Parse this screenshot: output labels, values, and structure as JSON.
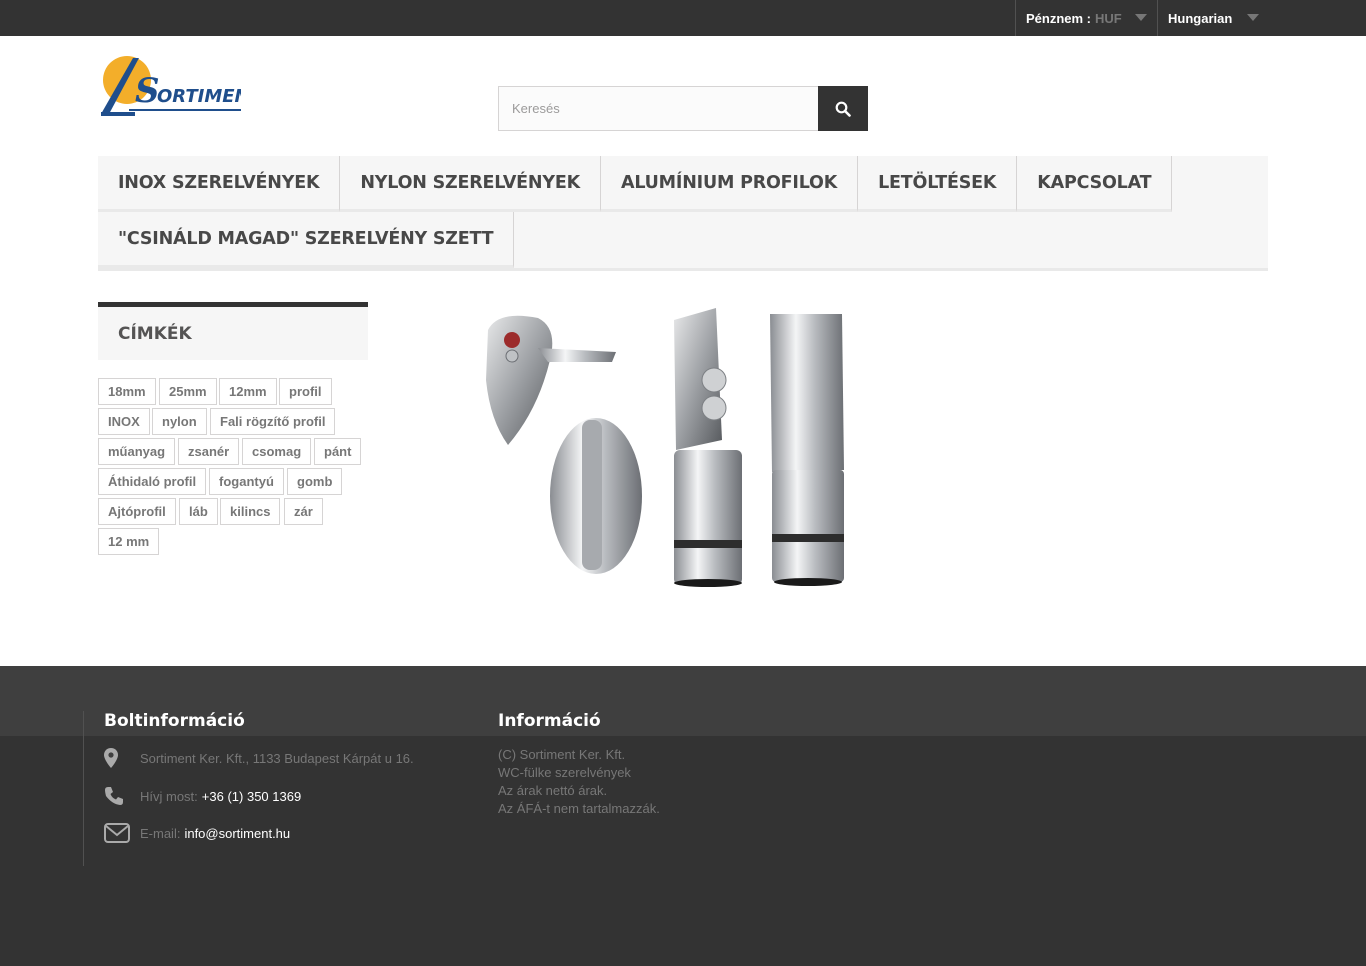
{
  "topbar": {
    "currency_label": "Pénznem :",
    "currency_value": "HUF",
    "language": "Hungarian"
  },
  "header": {
    "logo_text": "SORTIMENT",
    "search_placeholder": "Keresés",
    "search_icon": "search-icon"
  },
  "menu": {
    "row1": [
      "INOX SZERELVÉNYEK",
      "NYLON SZERELVÉNYEK",
      "ALUMÍNIUM PROFILOK",
      "LETÖLTÉSEK",
      "KAPCSOLAT"
    ],
    "row2": [
      "\"CSINÁLD MAGAD\" SZERELVÉNY SZETT"
    ]
  },
  "sidebar": {
    "title": "CÍMKÉK",
    "tags": [
      "18mm",
      "25mm",
      "12mm",
      "profil",
      "INOX",
      "nylon",
      "Fali rögzítő profil",
      "műanyag",
      "zsanér",
      "csomag",
      "pánt",
      "Áthidaló profil",
      "fogantyú",
      "gomb",
      "Ajtóprofil",
      "láb",
      "kilincs",
      "zár",
      "12 mm"
    ]
  },
  "footer": {
    "store_title": "Boltinformáció",
    "address": "Sortiment Ker. Kft., 1133 Budapest Kárpát u 16.",
    "phone_label": "Hívj most:",
    "phone": "+36 (1) 350 1369",
    "email_label": "E-mail:",
    "email": "info@sortiment.hu",
    "info_title": "Információ",
    "info_items": [
      "(C) Sortiment Ker. Kft.",
      "WC-fülke szerelvények",
      "Az árak nettó árak.",
      "Az ÁFÁ-t nem tartalmazzák."
    ]
  },
  "colors": {
    "dark": "#333333",
    "light_bg": "#f6f6f6",
    "muted_text": "#777777",
    "logo_blue": "#1f4e8c",
    "logo_orange": "#f0a020"
  }
}
